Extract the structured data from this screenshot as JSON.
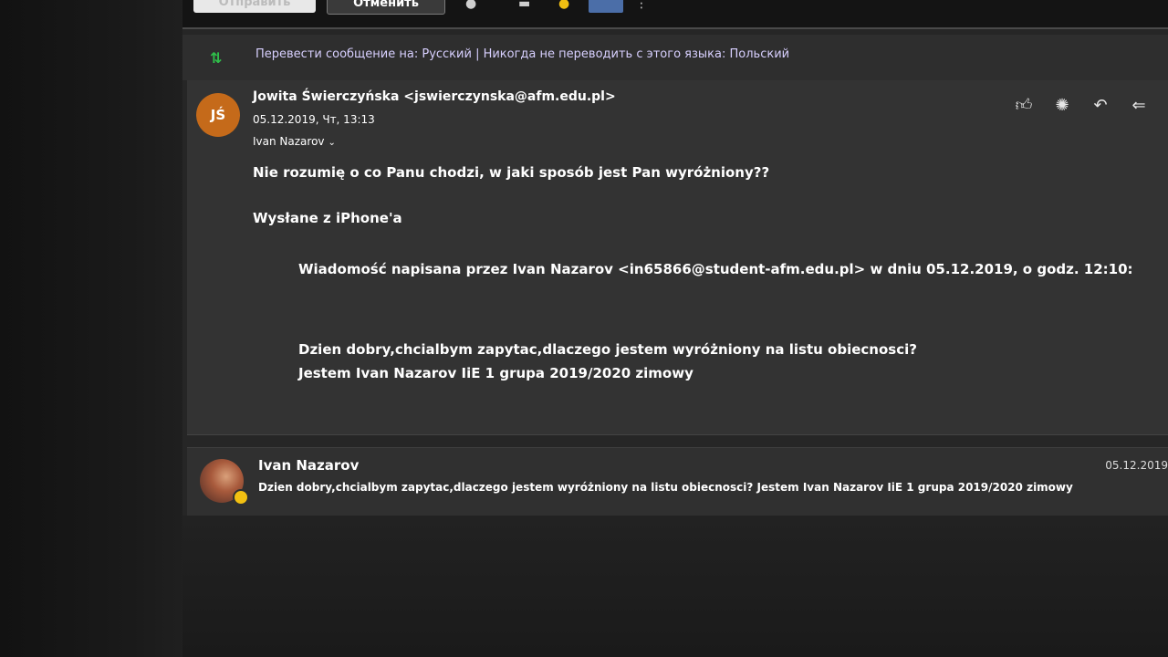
{
  "toolbar": {
    "send_label": "Отправить",
    "cancel_label": "Отменить",
    "icons": [
      "attach-icon",
      "image-icon",
      "emoji-icon",
      "format-icon",
      "more-icon"
    ]
  },
  "translate_bar": {
    "text": "Перевести сообщение на: Русский | Никогда не переводить с этого языка: Польский"
  },
  "message": {
    "avatar_initials": "JŚ",
    "sender": "Jowita Świerczyńska <jswierczynska@afm.edu.pl>",
    "date": "05.12.2019, Чт, 13:13",
    "recipient": "Ivan Nazarov",
    "actions": [
      "like-icon",
      "settings-icon",
      "reply-icon",
      "reply-all-icon"
    ],
    "body": {
      "line1": "Nie rozumię o co Panu chodzi, w jaki sposób jest Pan wyróżniony??",
      "line2": "Wysłane z iPhone'a",
      "quote_header": "Wiadomość napisana przez Ivan Nazarov <in65866@student-afm.edu.pl> w dniu 05.12.2019, o godz. 12:10:",
      "quote_line1": "Dzien dobry,chcialbym zapytac,dlaczego jestem wyróżniony na listu obiecnosci?",
      "quote_line2": "Jestem Ivan Nazarov IiE 1 grupa 2019/2020 zimowy"
    }
  },
  "thread_item": {
    "name": "Ivan Nazarov",
    "preview": "Dzien dobry,chcialbym zapytac,dlaczego jestem wyróżniony na listu obiecnosci? Jestem Ivan Nazarov IiE 1 grupa 2019/2020 zimowy",
    "date": "05.12.2019"
  }
}
